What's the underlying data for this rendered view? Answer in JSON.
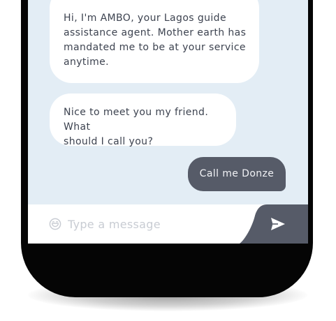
{
  "chat": {
    "messages": [
      {
        "from": "agent",
        "lines": [
          "Hi, I'm AMBO, your Lagos guide",
          "assistance agent. Mother earth has",
          "mandated me to be at your service",
          "anytime."
        ]
      },
      {
        "from": "agent",
        "lines": [
          "Nice to meet you my friend. What",
          "should I call you?"
        ]
      },
      {
        "from": "user",
        "text": "Call me Donze"
      }
    ]
  },
  "composer": {
    "placeholder": "Type a message",
    "emoji_icon": "smiley-face-icon",
    "send_icon": "paper-plane-icon"
  },
  "colors": {
    "chat_background": "#e3edf5",
    "agent_bubble": "#ffffff",
    "user_bubble": "#565b68",
    "send_button": "#565b68",
    "phone_frame": "#050505"
  }
}
